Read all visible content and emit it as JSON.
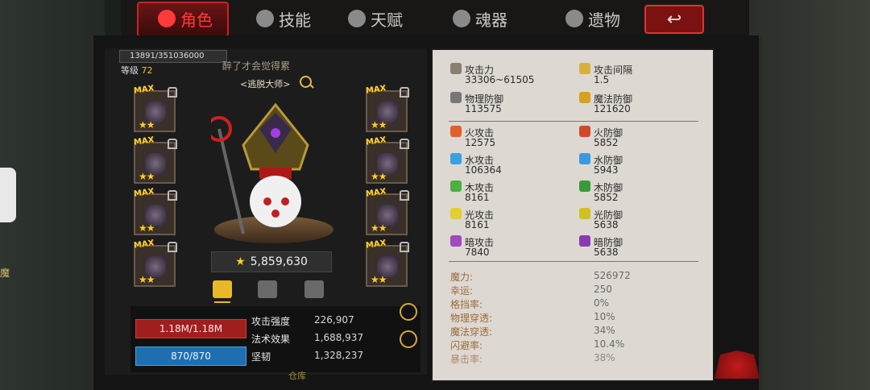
{
  "tabs": [
    {
      "label": "角色",
      "icon": "character-icon",
      "active": true
    },
    {
      "label": "技能",
      "icon": "skill-icon",
      "active": false
    },
    {
      "label": "天赋",
      "icon": "talent-icon",
      "active": false
    },
    {
      "label": "魂器",
      "icon": "soul-icon",
      "active": false
    },
    {
      "label": "遗物",
      "icon": "relic-icon",
      "active": false
    }
  ],
  "back_label": "↩",
  "side_label": "魔",
  "player": {
    "xp": "13891/351036000",
    "level_label": "等级",
    "level": "72",
    "title": "醉了才会觉得累",
    "subtitle": "<逃脱大师>",
    "power": "5,859,630"
  },
  "equipment": {
    "max_label": "MAX",
    "stars": "★★"
  },
  "bars": {
    "hp": "1.18M/1.18M",
    "mp": "870/870"
  },
  "combat": [
    {
      "label": "攻击强度",
      "value": "226,907"
    },
    {
      "label": "法术效果",
      "value": "1,688,937"
    },
    {
      "label": "坚韧",
      "value": "1,328,237"
    }
  ],
  "warehouse": "仓库",
  "stats_primary": [
    {
      "label": "攻击力",
      "value": "33306~61505",
      "icon": "sword-icon",
      "color": "#c8b070"
    },
    {
      "label": "攻击间隔",
      "value": "1.5",
      "icon": "speed-icon",
      "color": "#d8b040"
    },
    {
      "label": "物理防御",
      "value": "113575",
      "icon": "physical-defense-icon",
      "color": "#777"
    },
    {
      "label": "魔法防御",
      "value": "121620",
      "icon": "magic-defense-icon",
      "color": "#d8a020"
    }
  ],
  "stats_element": [
    {
      "label": "火攻击",
      "value": "12575",
      "icon": "fire-attack-icon",
      "color": "#e0602a"
    },
    {
      "label": "火防御",
      "value": "5852",
      "icon": "fire-defense-icon",
      "color": "#d04a2a"
    },
    {
      "label": "水攻击",
      "value": "106364",
      "icon": "water-attack-icon",
      "color": "#3aa0e0"
    },
    {
      "label": "水防御",
      "value": "5943",
      "icon": "water-defense-icon",
      "color": "#3a9ae0"
    },
    {
      "label": "木攻击",
      "value": "8161",
      "icon": "wood-attack-icon",
      "color": "#4ab040"
    },
    {
      "label": "木防御",
      "value": "5852",
      "icon": "wood-defense-icon",
      "color": "#3a9a3a"
    },
    {
      "label": "光攻击",
      "value": "8161",
      "icon": "light-attack-icon",
      "color": "#e0d030"
    },
    {
      "label": "光防御",
      "value": "5638",
      "icon": "light-defense-icon",
      "color": "#d0c020"
    },
    {
      "label": "暗攻击",
      "value": "7840",
      "icon": "dark-attack-icon",
      "color": "#a04ac0"
    },
    {
      "label": "暗防御",
      "value": "5638",
      "icon": "dark-defense-icon",
      "color": "#8a3ab0"
    }
  ],
  "stats_general": [
    {
      "label": "魔力:",
      "value": "526972"
    },
    {
      "label": "幸运:",
      "value": "250"
    },
    {
      "label": "格挡率:",
      "value": "0%"
    },
    {
      "label": "物理穿透:",
      "value": "10%"
    },
    {
      "label": "魔法穿透:",
      "value": "34%"
    },
    {
      "label": "闪避率:",
      "value": "10.4%"
    },
    {
      "label": "暴击率:",
      "value": "38%"
    }
  ]
}
